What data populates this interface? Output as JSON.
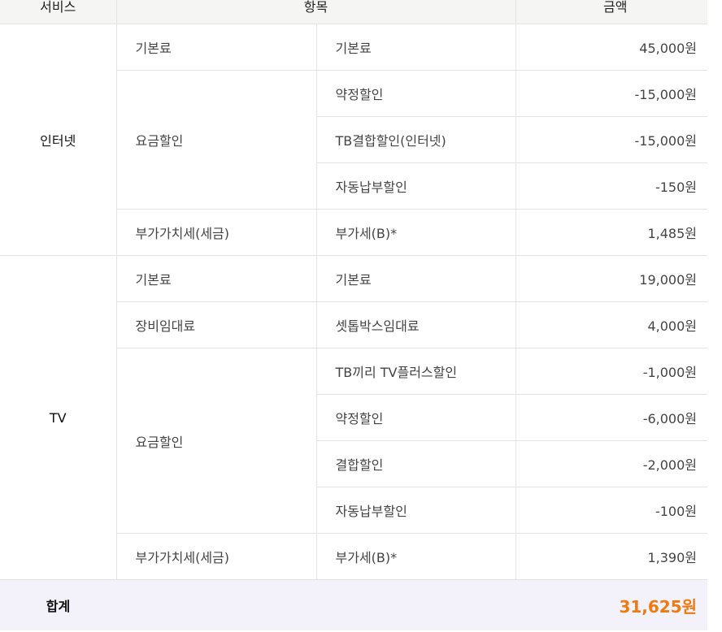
{
  "table": {
    "headers": {
      "service": "서비스",
      "item": "항목",
      "amount": "금액"
    },
    "internet": {
      "service": "인터넷",
      "base_fee_group": "기본료",
      "base_fee_item": "기본료",
      "base_fee_amount": "45,000원",
      "discount_group": "요금할인",
      "discount_items": [
        {
          "label": "약정할인",
          "amount": "-15,000원"
        },
        {
          "label": "TB결합할인(인터넷)",
          "amount": "-15,000원"
        },
        {
          "label": "자동납부할인",
          "amount": "-150원"
        }
      ],
      "vat_group": "부가가치세(세금)",
      "vat_item": "부가세(B)*",
      "vat_amount": "1,485원"
    },
    "tv": {
      "service": "TV",
      "base_fee_group": "기본료",
      "base_fee_item": "기본료",
      "base_fee_amount": "19,000원",
      "rental_group": "장비임대료",
      "rental_item": "셋톱박스임대료",
      "rental_amount": "4,000원",
      "discount_group": "요금할인",
      "discount_items": [
        {
          "label": "TB끼리 TV플러스할인",
          "amount": "-1,000원"
        },
        {
          "label": "약정할인",
          "amount": "-6,000원"
        },
        {
          "label": "결합할인",
          "amount": "-2,000원"
        },
        {
          "label": "자동납부할인",
          "amount": "-100원"
        }
      ],
      "vat_group": "부가가치세(세금)",
      "vat_item": "부가세(B)*",
      "vat_amount": "1,390원"
    },
    "total": {
      "label": "합계",
      "amount": "31,625원"
    }
  },
  "colors": {
    "header_bg": "#f5f5f3",
    "border": "#e3e3e3",
    "total_bg": "#f3f2fb",
    "total_amount": "#f07a10"
  }
}
